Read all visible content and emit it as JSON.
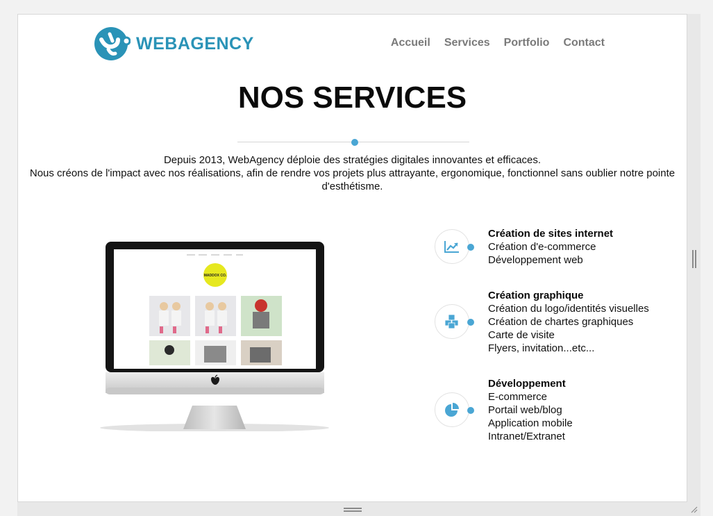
{
  "brand": {
    "name": "WEBAGENCY",
    "color": "#2a93b7",
    "accent": "#4aa6d4"
  },
  "nav": {
    "items": [
      {
        "label": "Accueil"
      },
      {
        "label": "Services"
      },
      {
        "label": "Portfolio"
      },
      {
        "label": "Contact"
      }
    ]
  },
  "hero": {
    "title": "NOS SERVICES",
    "intro_line1": "Depuis 2013, WebAgency déploie des stratégies digitales innovantes et efficaces.",
    "intro_line2": "Nous créons de l'impact avec nos réalisations, afin de rendre vos projets plus attrayante, ergonomique, fonctionnel sans oublier notre pointe d'esthétisme."
  },
  "mockup": {
    "logo_text": "MADDOX CO."
  },
  "services": [
    {
      "icon": "chart-icon",
      "title": "Création de sites internet",
      "items": [
        "Création d'e-commerce",
        "Développement web"
      ]
    },
    {
      "icon": "cubes-icon",
      "title": "Création graphique",
      "items": [
        "Création du logo/identités visuelles",
        "Création de chartes graphiques",
        "Carte de visite",
        "Flyers, invitation...etc..."
      ]
    },
    {
      "icon": "pie-chart-icon",
      "title": "Développement",
      "items": [
        "E-commerce",
        "Portail web/blog",
        "Application mobile",
        "Intranet/Extranet"
      ]
    }
  ]
}
